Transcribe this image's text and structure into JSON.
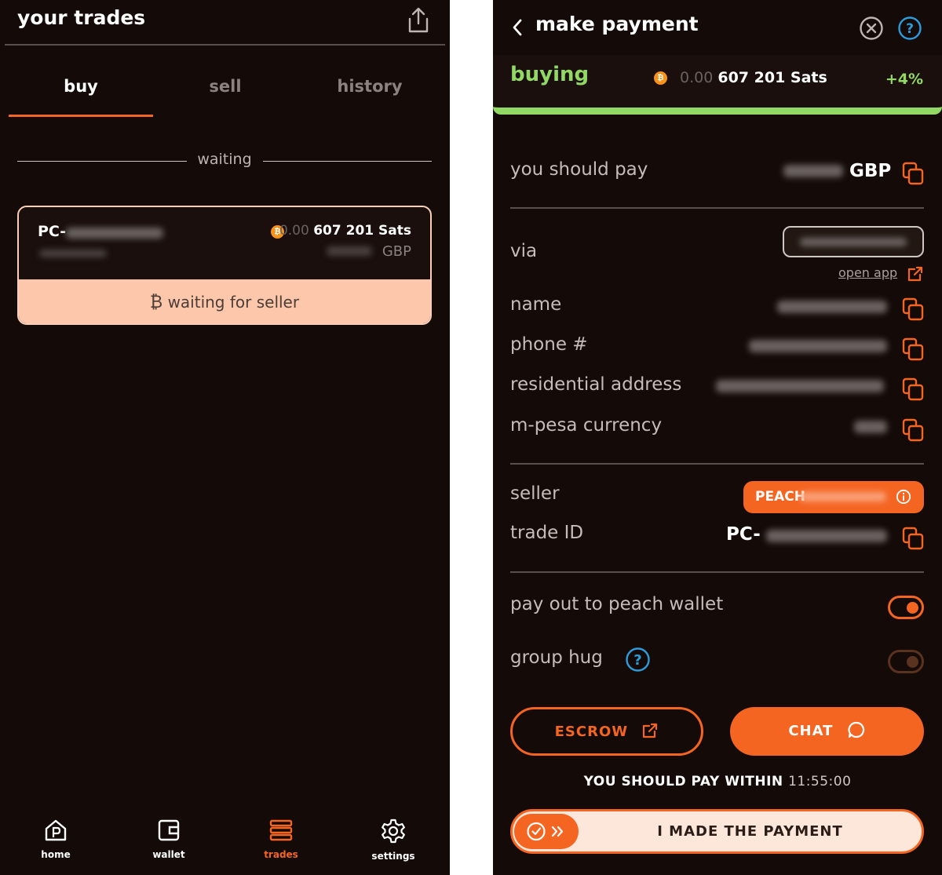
{
  "left_screen": {
    "title": "your trades",
    "tabs": [
      {
        "label": "buy",
        "active": true
      },
      {
        "label": "sell",
        "active": false
      },
      {
        "label": "history",
        "active": false
      }
    ],
    "section_label": "waiting",
    "trade_card": {
      "id_prefix": "PC-",
      "amount_dim": "0.00",
      "amount_bold": "607 201 Sats",
      "currency": "GBP",
      "status": "waiting for seller"
    },
    "nav": [
      {
        "label": "home",
        "icon": "home-icon",
        "active": false
      },
      {
        "label": "wallet",
        "icon": "wallet-icon",
        "active": false
      },
      {
        "label": "trades",
        "icon": "trades-icon",
        "active": true
      },
      {
        "label": "settings",
        "icon": "settings-icon",
        "active": false
      }
    ]
  },
  "right_screen": {
    "title": "make payment",
    "status": {
      "label": "buying",
      "amount_dim": "0.00",
      "amount_bold": "607 201 Sats",
      "premium": "+4%"
    },
    "rows": {
      "you_should_pay": "you should pay",
      "pay_currency": "GBP",
      "via": "via",
      "open_app": "open app",
      "name": "name",
      "phone": "phone #",
      "address": "residential address",
      "mpesa": "m-pesa currency",
      "seller": "seller",
      "seller_prefix": "PEACH",
      "trade_id": "trade ID",
      "trade_id_prefix": "PC-",
      "payout": "pay out to peach wallet",
      "group_hug": "group hug"
    },
    "toggles": {
      "payout_on": true,
      "group_hug_on": false
    },
    "escrow_button": "ESCROW",
    "chat_button": "CHAT",
    "pay_within_label": "YOU SHOULD PAY WITHIN",
    "timer": "11:55:00",
    "slider_label": "I MADE THE PAYMENT"
  },
  "colors": {
    "background": "#140b08",
    "accent": "#f56522",
    "success": "#91d864",
    "info": "#2d9cdb",
    "card_status": "#fcc7ab"
  }
}
